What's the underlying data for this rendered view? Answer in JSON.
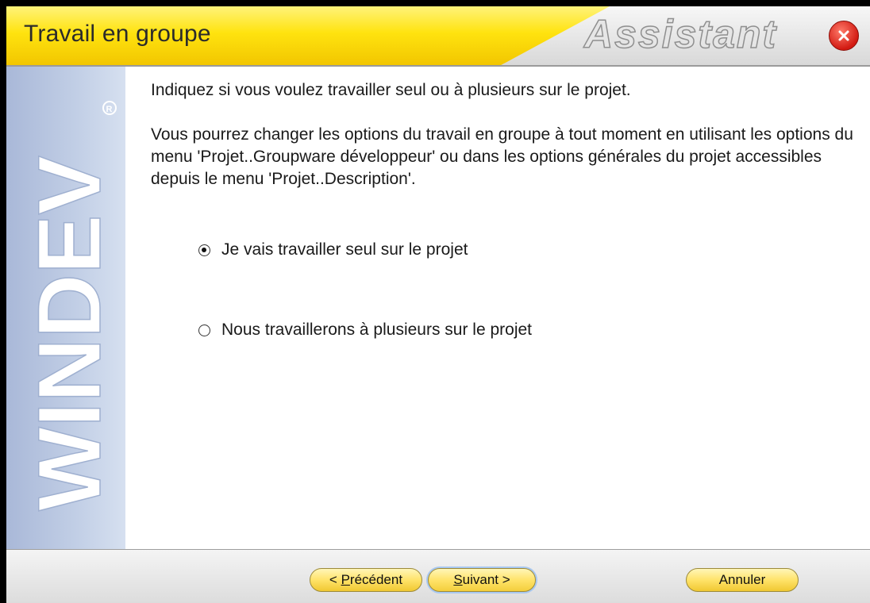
{
  "window": {
    "title": "Travail en groupe",
    "wordmark": "Assistant",
    "banner_text": "WINDEV",
    "colors": {
      "title_yellow": "#ffe30f",
      "button_yellow": "#ffe36a",
      "close_red": "#d21a12",
      "banner_blue": "#b9c7e2"
    }
  },
  "content": {
    "intro": "Indiquez si vous voulez travailler seul ou à plusieurs sur le projet.",
    "details": "Vous pourrez changer les options du travail en groupe à tout moment en utilisant les options du menu 'Projet..Groupware développeur' ou dans les options générales du projet accessibles depuis le menu 'Projet..Description'.",
    "options": [
      {
        "label": "Je vais travailler seul sur le projet",
        "selected": true
      },
      {
        "label": "Nous travaillerons à plusieurs sur le projet",
        "selected": false
      }
    ]
  },
  "footer": {
    "prev_prefix": "< ",
    "prev_key": "P",
    "prev_rest": "récédent",
    "next_key": "S",
    "next_rest": "uivant >",
    "cancel_label": "Annuler"
  },
  "icons": {
    "close": "close-icon",
    "radio_selected": "radio-selected-icon",
    "radio_unselected": "radio-unselected-icon"
  }
}
